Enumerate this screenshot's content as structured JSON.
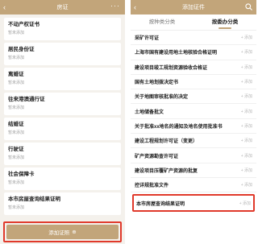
{
  "left": {
    "header": {
      "back_icon": "‹",
      "title": "房证",
      "more_icon": "···"
    },
    "cards": [
      {
        "name": "不动产权证书",
        "status": "暂未添加"
      },
      {
        "name": "居民身份证",
        "status": "暂未添加"
      },
      {
        "name": "离婚证",
        "status": "暂未添加"
      },
      {
        "name": "往来港澳通行证",
        "status": "暂未添加"
      },
      {
        "name": "结婚证",
        "status": "暂未添加"
      },
      {
        "name": "行驶证",
        "status": "暂未添加"
      },
      {
        "name": "社会保障卡",
        "status": "暂未添加"
      },
      {
        "name": "本市房屋查询结果证明",
        "status": "暂未添加"
      }
    ],
    "add_button": {
      "label": "添加证照",
      "icon": "⊕"
    }
  },
  "right": {
    "header": {
      "back_icon": "‹",
      "title": "添加证件",
      "search_icon": "search-icon"
    },
    "tabs": [
      {
        "label": "按种类分类",
        "active": false
      },
      {
        "label": "按委办分类",
        "active": true
      }
    ],
    "items": [
      {
        "label": "采矿许可证",
        "action": "+ 添加"
      },
      {
        "label": "上海市国有建设用地土地核验合格证明",
        "action": "+ 添加"
      },
      {
        "label": "建设项目竣工规划资源验收合格证",
        "action": "+ 添加"
      },
      {
        "label": "国有土地划拨决定书",
        "action": "+ 添加"
      },
      {
        "label": "关于地图审核批准的决定",
        "action": "+ 添加"
      },
      {
        "label": "土地储备批文",
        "action": "+ 添加"
      },
      {
        "label": "关于批准xx地名的通知及地名使用批准书",
        "action": "+ 添加"
      },
      {
        "label": "建设工程规划许可证（变更）",
        "action": "+ 添加"
      },
      {
        "label": "矿产资源勘查许可证",
        "action": "+ 添加"
      },
      {
        "label": "建设项目压覆矿产资源的批复",
        "action": "+ 添加"
      },
      {
        "label": "控详规批准文件",
        "action": "+ 添加"
      },
      {
        "label": "本市房屋查询结果证明",
        "action": "+ 添加"
      }
    ]
  },
  "colors": {
    "accent": "#c2a57a",
    "highlight": "#e0392b"
  }
}
